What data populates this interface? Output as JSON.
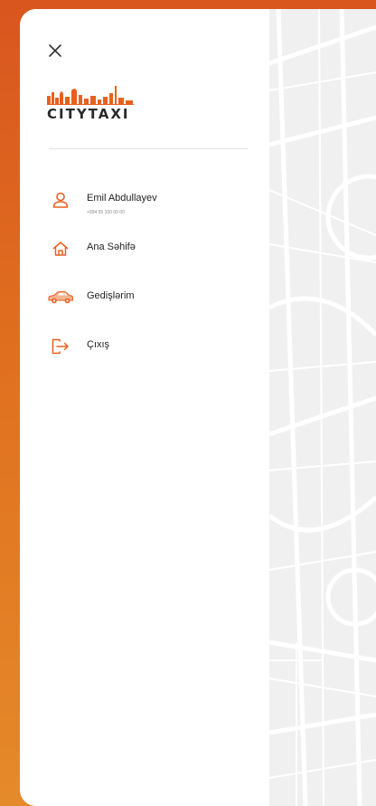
{
  "colors": {
    "accent": "#e8601f",
    "background_gradient_top": "#d9561f",
    "background_gradient_bottom": "#e58a2a",
    "text": "#222222"
  },
  "header": {
    "close_icon": "close-icon",
    "logo_text": "CITYTAXI"
  },
  "user": {
    "name": "Emil Abdullayev",
    "phone": "+994 55 100 00 00",
    "icon": "user-icon"
  },
  "menu": {
    "items": [
      {
        "label": "Ana Səhifə",
        "icon": "home-icon"
      },
      {
        "label": "Gedişlərim",
        "icon": "car-icon"
      },
      {
        "label": "Çıxış",
        "icon": "logout-icon"
      }
    ]
  }
}
